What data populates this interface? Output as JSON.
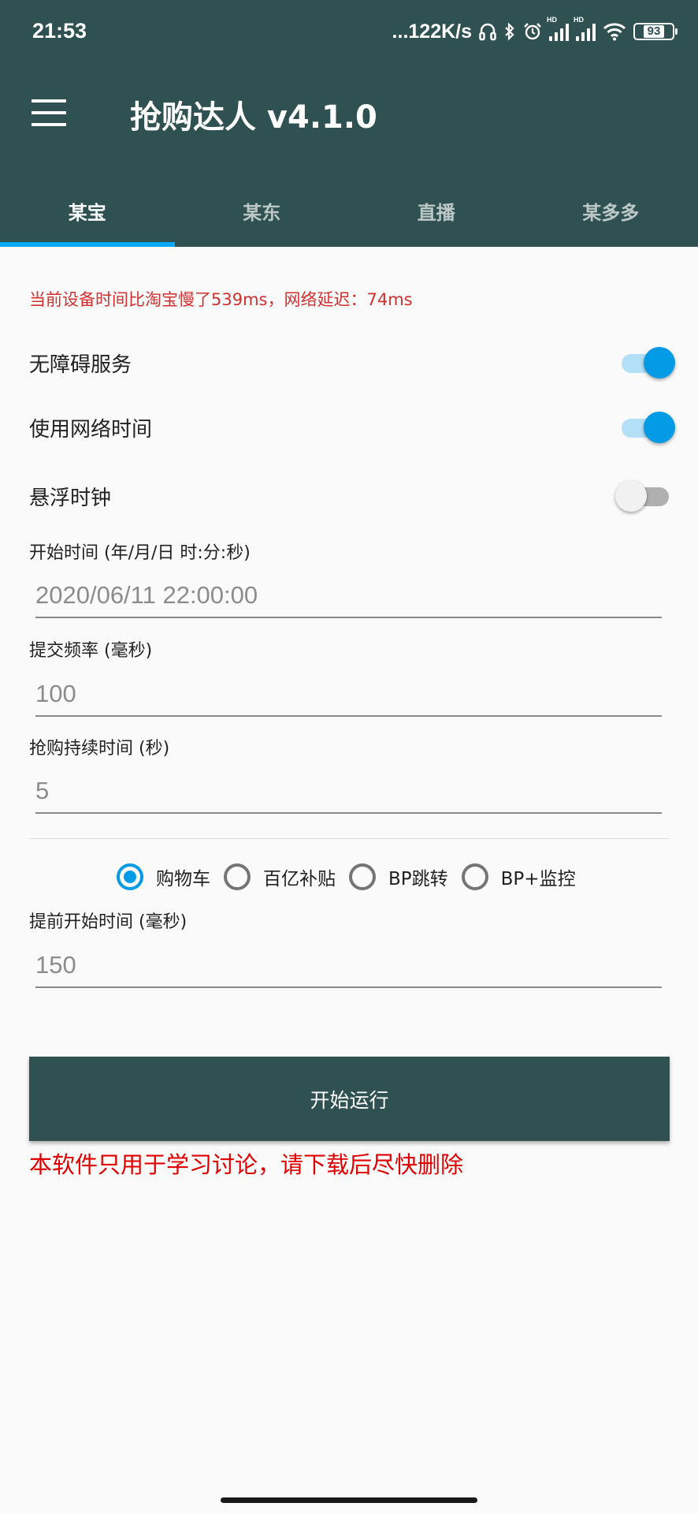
{
  "status_bar": {
    "time": "21:53",
    "network_speed": "...122K/s",
    "battery": "93",
    "icons": [
      "headset-icon",
      "bluetooth-icon",
      "alarm-icon",
      "signal-hd-icon",
      "signal-hd-icon",
      "wifi-icon",
      "battery-icon"
    ]
  },
  "app_bar": {
    "title": "抢购达人 v4.1.0",
    "menu_icon": "menu-icon",
    "background": "#2f5151"
  },
  "tabs": [
    {
      "label": "某宝",
      "active": true
    },
    {
      "label": "某东",
      "active": false
    },
    {
      "label": "直播",
      "active": false
    },
    {
      "label": "某多多",
      "active": false
    }
  ],
  "warning": "当前设备时间比淘宝慢了539ms，网络延迟：74ms",
  "toggles": [
    {
      "label": "无障碍服务",
      "on": true
    },
    {
      "label": "使用网络时间",
      "on": true
    },
    {
      "label": "悬浮时钟",
      "on": false
    }
  ],
  "fields": {
    "start_time": {
      "label": "开始时间 (年/月/日 时:分:秒)",
      "value": "2020/06/11 22:00:00"
    },
    "submit_frequency": {
      "label": "提交频率 (毫秒)",
      "value": "100"
    },
    "duration": {
      "label": "抢购持续时间 (秒)",
      "value": "5"
    },
    "advance_time": {
      "label": "提前开始时间 (毫秒)",
      "value": "150"
    }
  },
  "radios": [
    {
      "label": "购物车",
      "checked": true
    },
    {
      "label": "百亿补贴",
      "checked": false
    },
    {
      "label": "BP跳转",
      "checked": false
    },
    {
      "label": "BP+监控",
      "checked": false
    }
  ],
  "start_button": "开始运行",
  "disclaimer": "本软件只用于学习讨论，请下载后尽快删除",
  "colors": {
    "primary": "#2f5151",
    "accent": "#039be5",
    "warning": "#d32f2f",
    "disclaimer": "#e00000"
  }
}
